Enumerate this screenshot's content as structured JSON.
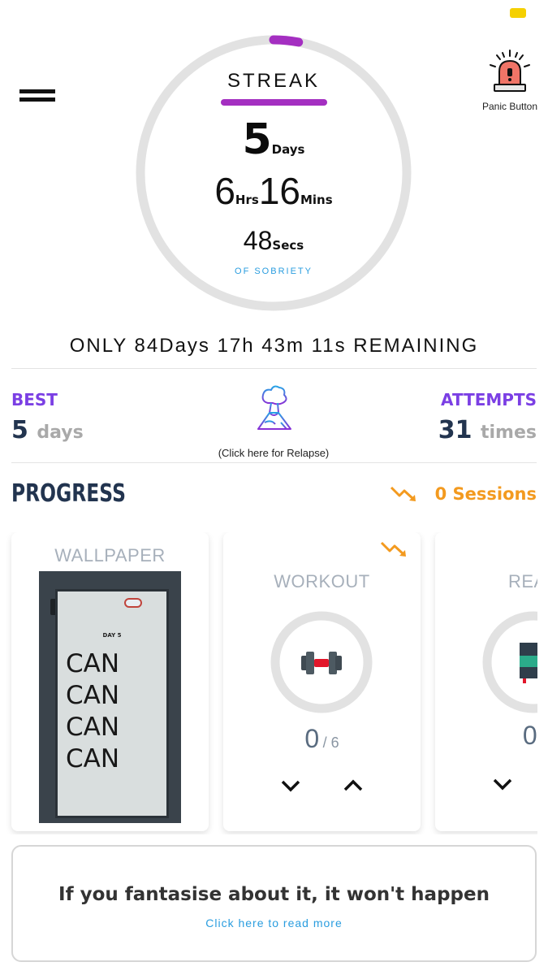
{
  "header": {
    "menu_icon": "hamburger-menu-icon",
    "panic_icon": "siren-alarm-icon",
    "panic_label": "Panic Button"
  },
  "streak": {
    "title": "STREAK",
    "days_value": "5",
    "days_unit": "Days",
    "hours_value": "6",
    "hours_unit": "Hrs",
    "minutes_value": "16",
    "minutes_unit": "Mins",
    "seconds_value": "48",
    "seconds_unit": "Secs",
    "subtitle": "OF SOBRIETY",
    "ring_progress_fraction": 0.06,
    "accent_color": "#a42fc1"
  },
  "remaining_text": "ONLY 84Days 17h 43m 11s REMAINING",
  "stats": {
    "best_label": "BEST",
    "best_value": "5",
    "best_unit": "days",
    "attempts_label": "ATTEMPTS",
    "attempts_value": "31",
    "attempts_unit": "times",
    "relapse_icon": "volcano-icon",
    "relapse_label": "(Click here for Relapse)"
  },
  "progress": {
    "title": "PROGRESS",
    "trend_icon": "trending-down-icon",
    "sessions_text": "0 Sessions",
    "cards": [
      {
        "title": "WALLPAPER",
        "image_day_text": "DAY 5",
        "image_words": [
          "CAN",
          "CAN",
          "CAN",
          "CAN"
        ]
      },
      {
        "title": "WORKOUT",
        "icon": "dumbbell-icon",
        "count_value": "0",
        "count_total": "/ 6",
        "progress_fraction": 0
      },
      {
        "title": "READ",
        "icon": "book-icon",
        "count_value": "0",
        "count_total": "/"
      }
    ]
  },
  "quote": {
    "text": "If you fantasise about it, it won't happen",
    "link_text": "Click here to read more"
  }
}
